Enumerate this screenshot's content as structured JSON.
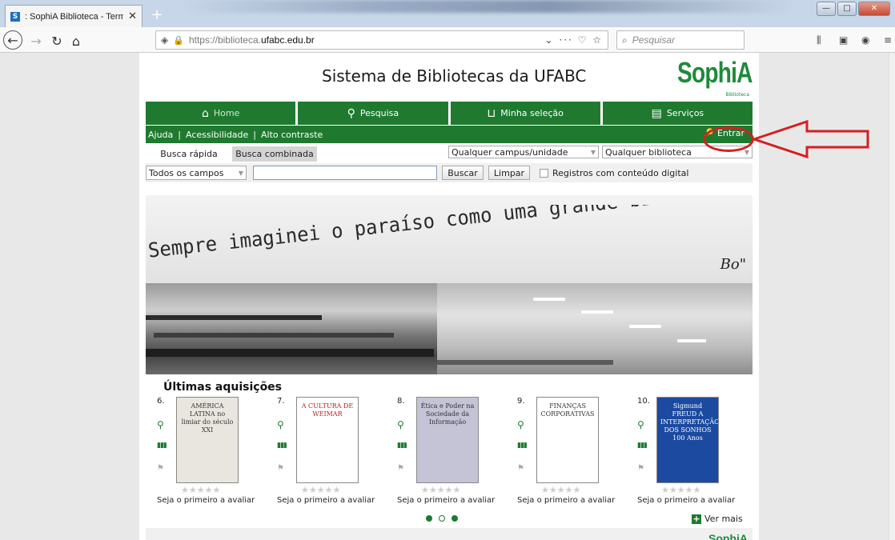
{
  "browser": {
    "tab_title": ": SophiA Biblioteca - Terminal",
    "tab_favicon": "S",
    "tab_close": "✕",
    "new_tab": "+",
    "url_prefix": "https://biblioteca.",
    "url_domain": "ufabc.edu.br",
    "url_extra": "⌄ ··· ♡ ☆",
    "search_placeholder": "Pesquisar"
  },
  "site": {
    "title": "Sistema de Bibliotecas da UFABC",
    "logo": "SophiA",
    "logo_sub": "Biblioteca",
    "menu": [
      {
        "label": "Home",
        "icon": "home-icon",
        "glyph": "⌂"
      },
      {
        "label": "Pesquisa",
        "icon": "search-icon",
        "glyph": "🔍"
      },
      {
        "label": "Minha seleção",
        "icon": "basket-icon",
        "glyph": "🧺"
      },
      {
        "label": "Serviços",
        "icon": "services-icon",
        "glyph": "▤"
      }
    ],
    "links": [
      "Ajuda",
      "Acessibilidade",
      "Alto contraste"
    ],
    "login": "Entrar"
  },
  "search": {
    "tab_quick": "Busca rápida",
    "tab_combined": "Busca combinada",
    "campus_select": "Qualquer campus/unidade",
    "library_select": "Qualquer biblioteca",
    "field_select": "Todos os campos",
    "query_value": "",
    "search_button": "Buscar",
    "clear_button": "Limpar",
    "digital_label": "Registros com conteúdo digital",
    "digital_checked": false
  },
  "banner": {
    "quote": "Sempre imaginei o paraíso como uma grande biblioteca",
    "signature": "Bo\""
  },
  "acquisitions": {
    "title": "Últimas aquisições",
    "rating_text": "Seja o primeiro a avaliar",
    "stars": "★★★★★",
    "items": [
      {
        "number": "6.",
        "cover_text": "AMÉRICA LATINA no limiar do século XXI",
        "cover_color": "#e9e6df"
      },
      {
        "number": "7.",
        "cover_text": "A CULTURA DE WEIMAR",
        "cover_color": "#ffffff"
      },
      {
        "number": "8.",
        "cover_text": "Ética e Poder na Sociedade da Informação",
        "cover_color": "#c5c3d6"
      },
      {
        "number": "9.",
        "cover_text": "FINANÇAS CORPORATIVAS",
        "cover_color": "#ffffff"
      },
      {
        "number": "10.",
        "cover_text": "Sigmund FREUD A INTERPRETAÇÃO DOS SONHOS 100 Anos",
        "cover_color": "#1b4aa0"
      }
    ],
    "see_more": "Ver mais",
    "pager_active": 0
  },
  "footer": {
    "logo": "SophiA"
  },
  "colors": {
    "green": "#1f7a30",
    "annotation_red": "#d42020"
  }
}
